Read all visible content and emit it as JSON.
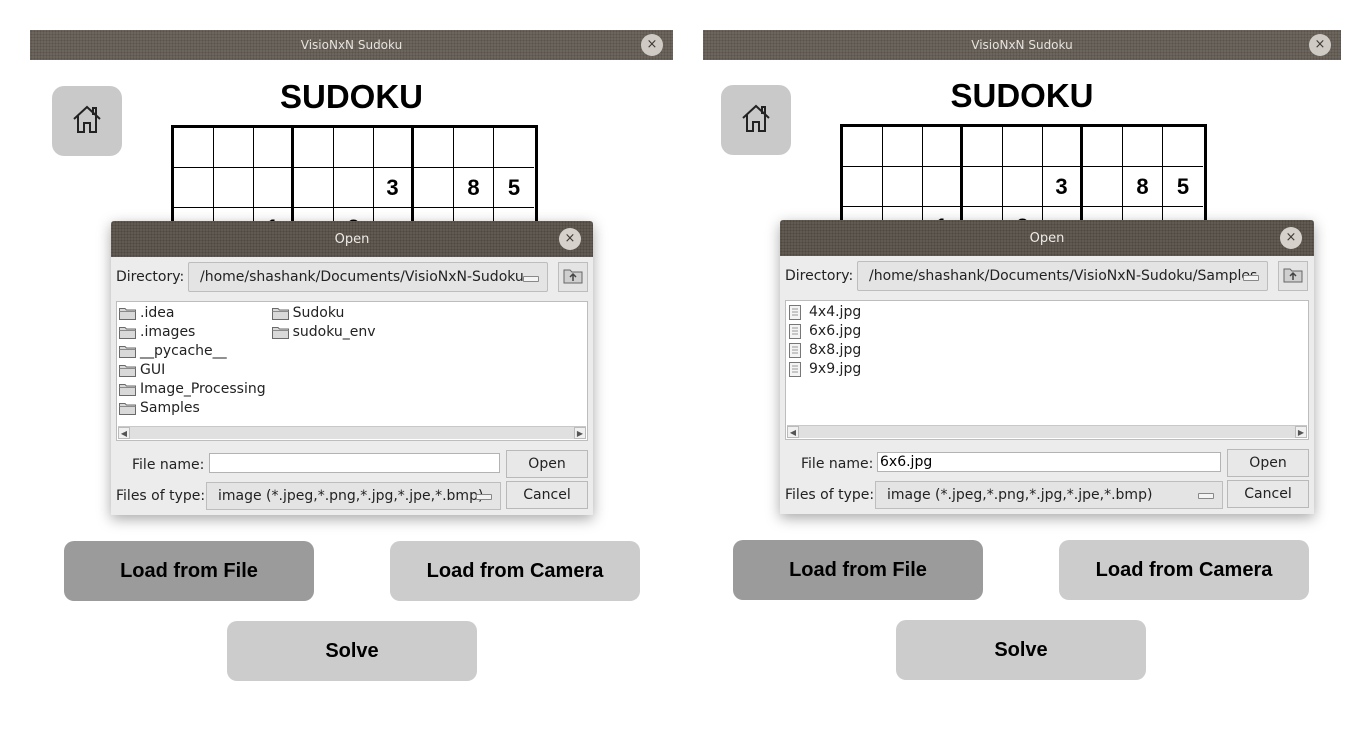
{
  "windows": [
    {
      "title": "VisioNxN Sudoku",
      "close_glyph": "×",
      "app_title": "SUDOKU",
      "grid_rows": [
        [
          "",
          "",
          "",
          "",
          "",
          "",
          "",
          "",
          ""
        ],
        [
          "",
          "",
          "",
          "",
          "",
          "3",
          "",
          "8",
          "5"
        ],
        [
          "",
          "",
          "1",
          "",
          "2",
          "",
          "",
          "",
          ""
        ]
      ],
      "dialog": {
        "title": "Open",
        "directory_label": "Directory:",
        "directory_value": "/home/shashank/Documents/VisioNxN-Sudoku",
        "files_col1": [
          {
            "name": ".idea",
            "icon": "folder-icon"
          },
          {
            "name": ".images",
            "icon": "folder-icon"
          },
          {
            "name": "__pycache__",
            "icon": "folder-icon"
          },
          {
            "name": "GUI",
            "icon": "folder-icon"
          },
          {
            "name": "Image_Processing",
            "icon": "folder-icon"
          },
          {
            "name": "Samples",
            "icon": "folder-icon"
          }
        ],
        "files_col2": [
          {
            "name": "Sudoku",
            "icon": "folder-icon"
          },
          {
            "name": "sudoku_env",
            "icon": "folder-icon"
          }
        ],
        "file_name_label": "File name:",
        "file_name_value": "",
        "open_label": "Open",
        "file_type_label": "Files of type:",
        "file_type_value": "image (*.jpeg,*.png,*.jpg,*.jpe,*.bmp)",
        "cancel_label": "Cancel"
      },
      "buttons": {
        "load_file": "Load from File",
        "load_camera": "Load from Camera",
        "solve": "Solve"
      }
    },
    {
      "title": "VisioNxN Sudoku",
      "close_glyph": "×",
      "app_title": "SUDOKU",
      "grid_rows": [
        [
          "",
          "",
          "",
          "",
          "",
          "",
          "",
          "",
          ""
        ],
        [
          "",
          "",
          "",
          "",
          "",
          "3",
          "",
          "8",
          "5"
        ],
        [
          "",
          "",
          "1",
          "",
          "2",
          "",
          "",
          "",
          ""
        ]
      ],
      "dialog": {
        "title": "Open",
        "directory_label": "Directory:",
        "directory_value": "/home/shashank/Documents/VisioNxN-Sudoku/Samples",
        "files_col1": [
          {
            "name": "4x4.jpg",
            "icon": "file-icon"
          },
          {
            "name": "6x6.jpg",
            "icon": "file-icon"
          },
          {
            "name": "8x8.jpg",
            "icon": "file-icon"
          },
          {
            "name": "9x9.jpg",
            "icon": "file-icon"
          }
        ],
        "files_col2": [],
        "file_name_label": "File name:",
        "file_name_value": "6x6.jpg",
        "open_label": "Open",
        "file_type_label": "Files of type:",
        "file_type_value": "image (*.jpeg,*.png,*.jpg,*.jpe,*.bmp)",
        "cancel_label": "Cancel"
      },
      "buttons": {
        "load_file": "Load from File",
        "load_camera": "Load from Camera",
        "solve": "Solve"
      }
    }
  ]
}
